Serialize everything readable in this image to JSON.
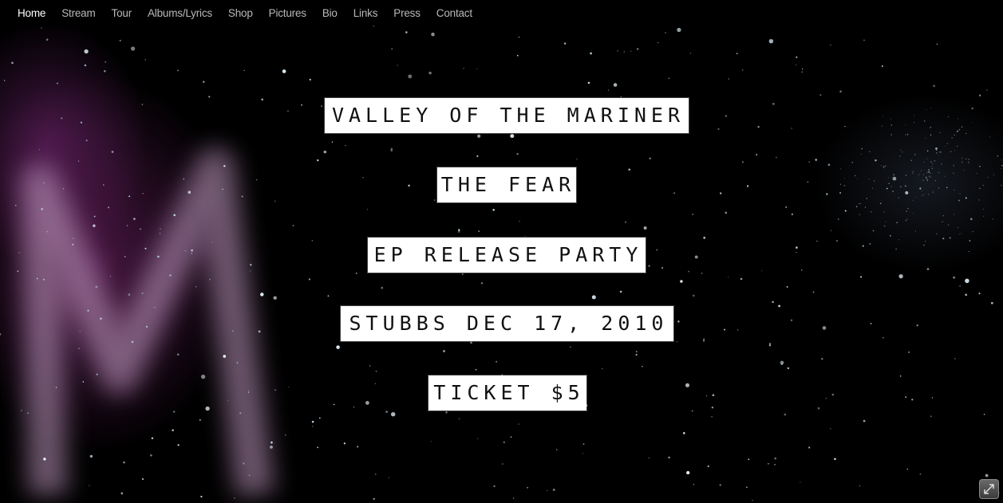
{
  "nav": {
    "items": [
      {
        "label": "Home",
        "active": true
      },
      {
        "label": "Stream",
        "active": false
      },
      {
        "label": "Tour",
        "active": false
      },
      {
        "label": "Albums/Lyrics",
        "active": false
      },
      {
        "label": "Shop",
        "active": false
      },
      {
        "label": "Pictures",
        "active": false
      },
      {
        "label": "Bio",
        "active": false
      },
      {
        "label": "Links",
        "active": false
      },
      {
        "label": "Press",
        "active": false
      },
      {
        "label": "Contact",
        "active": false
      }
    ]
  },
  "banner": {
    "lines": [
      "Valley of the Mariner",
      "The Fear",
      "EP Release Party",
      "Stubbs Dec 17, 2010",
      "Ticket $5"
    ]
  },
  "background": {
    "description_icon": "starfield-with-purple-m-glow",
    "accent": "#8a2f86"
  },
  "controls": {
    "fullscreen_icon": "expand-icon"
  }
}
